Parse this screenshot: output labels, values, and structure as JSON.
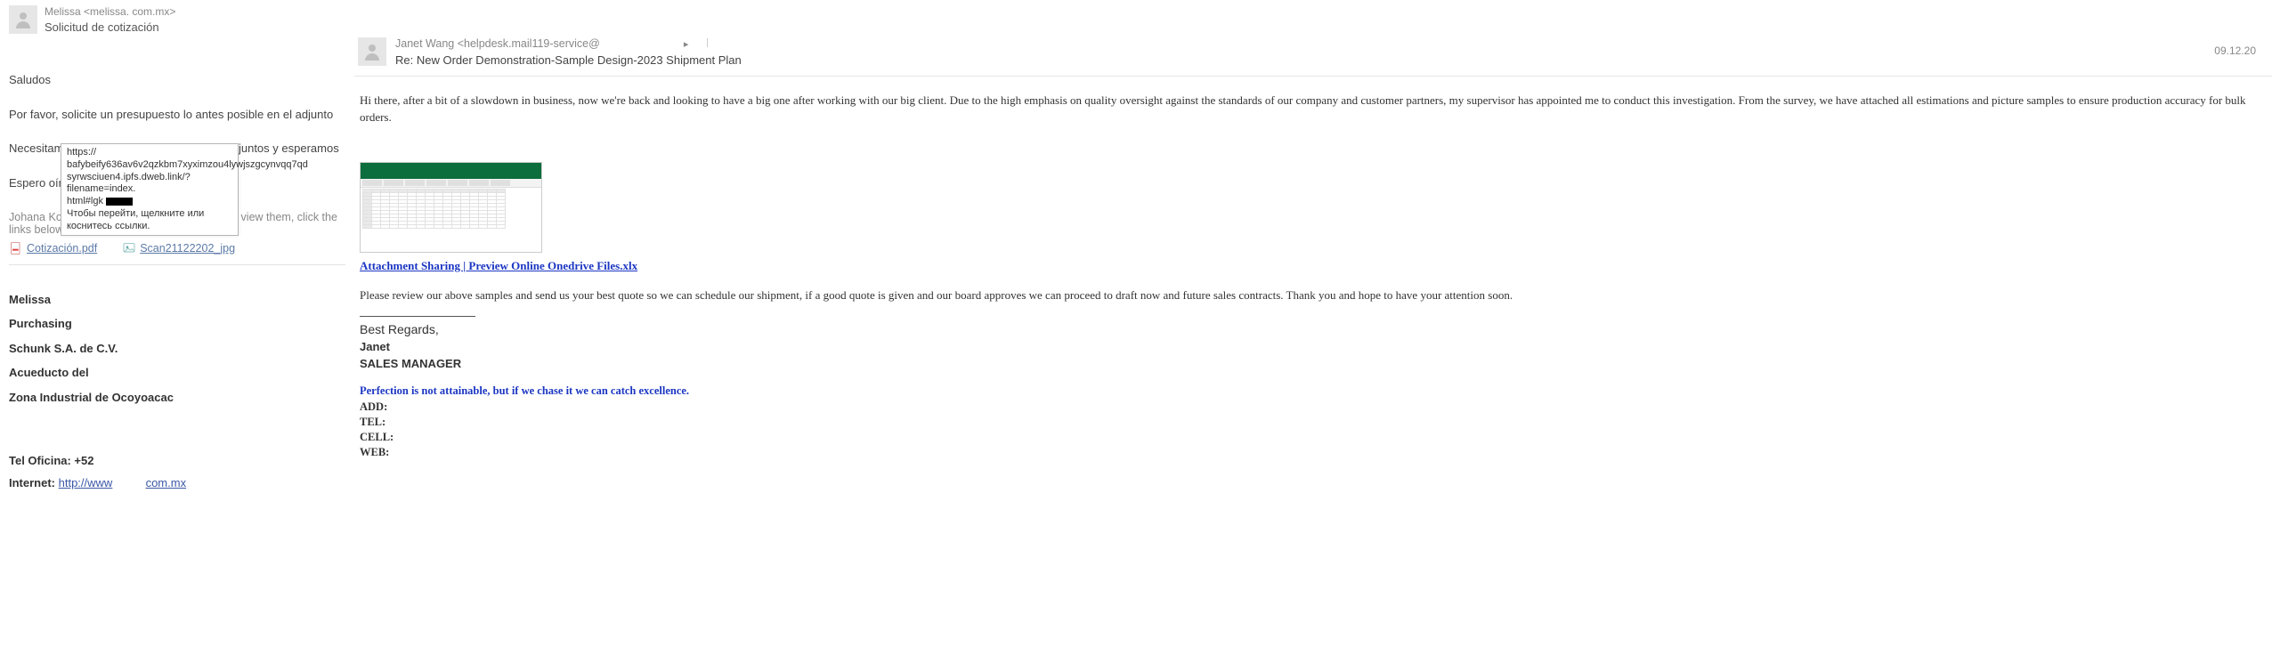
{
  "left": {
    "sender_line": "Melissa          <melissa.                           com.mx>",
    "subject": "Solicitud de cotización",
    "p1": "Saludos",
    "p2": "Por favor, solicite un presupuesto lo antes posible en el adjunto",
    "p3": "Necesitamos urgentemente los productos adjuntos y esperamos",
    "p4": "Espero oír sobr",
    "p5": "Johana Koutn",
    "attach_tail": ". To view them, click the links below.",
    "attachments": {
      "pdf": "Cotización.pdf",
      "jpg": "Scan21122202_jpg"
    },
    "tooltip": {
      "l1": "https://",
      "l2": "bafybeify636av6v2qzkbm7xyximzou4lywjszgcynvqq7qd",
      "l3": "syrwsciuen4.ipfs.dweb.link/?filename=index.",
      "l4a": "html#lgk ",
      "l5": "Чтобы перейти, щелкните или коснитесь ссылки."
    },
    "signature": {
      "name": "Melissa",
      "role": "Purchasing",
      "company": "Schunk S.A. de C.V.",
      "street": "Acueducto del",
      "zone": "Zona Industrial de Ocoyoacac",
      "tel_label": "Tel Oficina: +52",
      "internet_label": "Internet: ",
      "url1": "http://www",
      "url2": "com.mx"
    }
  },
  "right": {
    "sender_line": "Janet Wang <helpdesk.mail119-service@",
    "subject": "Re: New Order Demonstration-Sample Design-2023 Shipment Plan",
    "date": "09.12.20",
    "intro": "Hi there, after a bit of a slowdown in business, now we're back and looking to have a big one after working with our big client. Due to the high emphasis on quality oversight against the standards of our company and customer partners, my supervisor has appointed me to conduct this investigation. From the survey, we have attached all estimations and picture samples to ensure production accuracy for bulk orders.",
    "attach_link": "Attachment Sharing | Preview Online Onedrive Files.xlx",
    "followup": "Please review our above samples and send us your best quote so we can schedule our shipment, if a good quote is given and our board approves we can proceed to draft now and future sales contracts. Thank you and hope to have your attention soon.",
    "sig": {
      "best": "Best Regards,",
      "name": "Janet",
      "title": "SALES MANAGER"
    },
    "quote": "Perfection is not attainable, but if we chase it we can catch excellence.",
    "fields": {
      "add": "ADD:",
      "tel": "TEL:",
      "cell": "CELL:",
      "web": "WEB:"
    }
  }
}
